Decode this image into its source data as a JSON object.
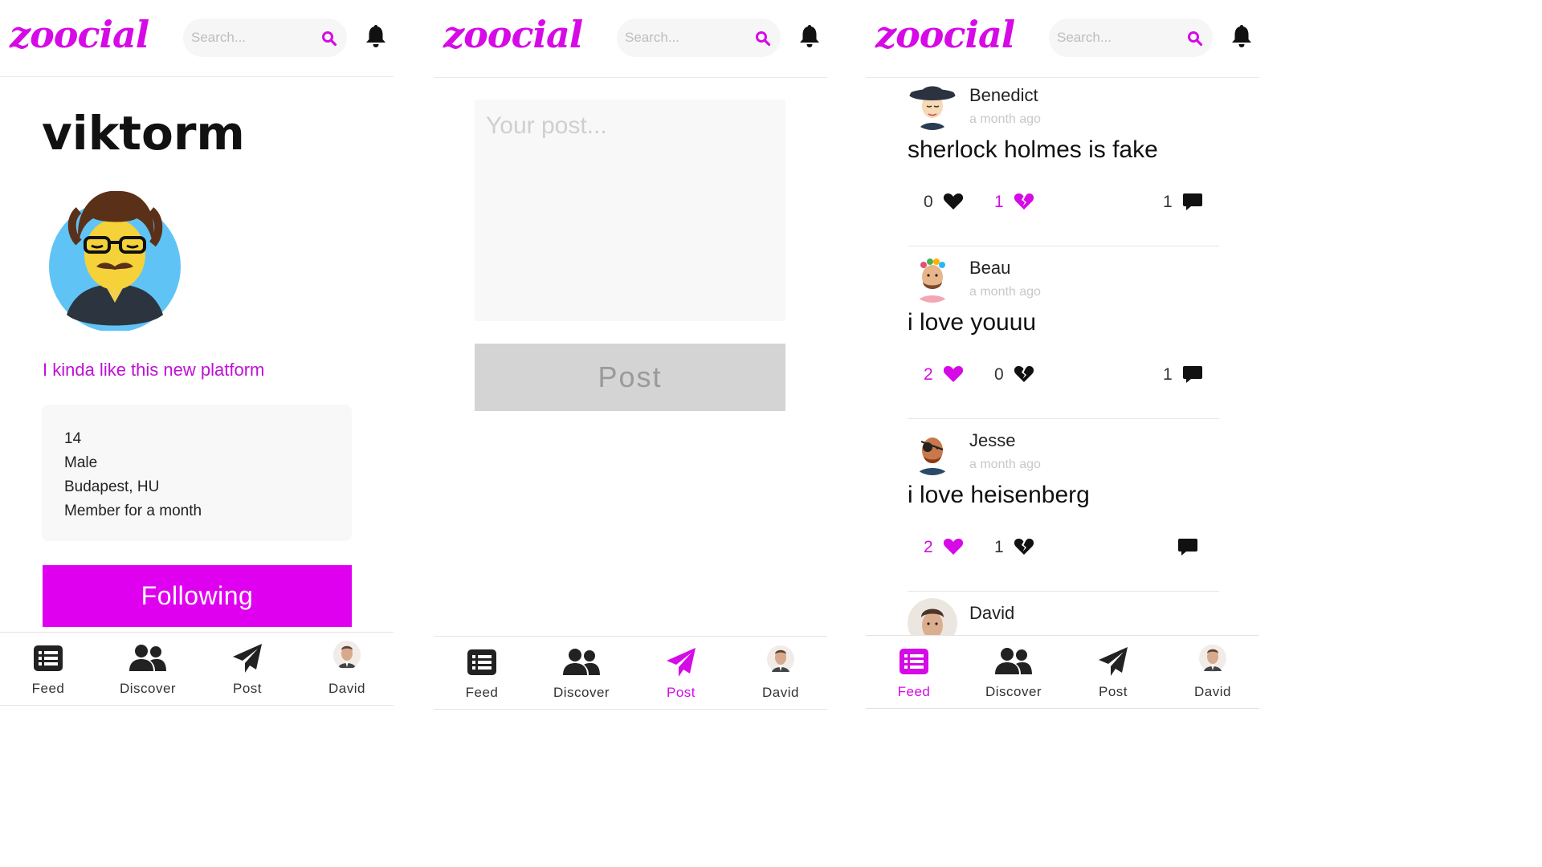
{
  "panels": [
    {
      "header": {
        "logo": "zoocial",
        "search_placeholder": "Search..."
      },
      "profile": {
        "username": "viktorm",
        "bio": "I kinda like this new platform",
        "info": [
          "14",
          "Male",
          "Budapest, HU",
          "Member for a month"
        ],
        "follow_label": "Following"
      },
      "nav": {
        "items": [
          "Feed",
          "Discover",
          "Post",
          "David"
        ],
        "active": ""
      }
    },
    {
      "header": {
        "logo": "zoocial",
        "search_placeholder": "Search..."
      },
      "compose": {
        "placeholder": "Your post...",
        "post_label": "Post"
      },
      "nav": {
        "items": [
          "Feed",
          "Discover",
          "Post",
          "David"
        ],
        "active": "Post"
      }
    },
    {
      "header": {
        "logo": "zoocial",
        "search_placeholder": "Search..."
      },
      "feed": [
        {
          "author": "Benedict",
          "time": "a month ago",
          "text": "sherlock holmes is fake",
          "likes": "0",
          "broken": "1",
          "comments": "1",
          "liked": false,
          "broken_active": true
        },
        {
          "author": "Beau",
          "time": "a month ago",
          "text": "i love youuu",
          "likes": "2",
          "broken": "0",
          "comments": "1",
          "liked": true,
          "broken_active": false
        },
        {
          "author": "Jesse",
          "time": "a month ago",
          "text": "i love heisenberg",
          "likes": "2",
          "broken": "1",
          "comments": "",
          "liked": true,
          "broken_active": false
        },
        {
          "author": "David"
        }
      ],
      "nav": {
        "items": [
          "Feed",
          "Discover",
          "Post",
          "David"
        ],
        "active": "Feed"
      }
    }
  ],
  "colors": {
    "accent": "#d60ae6",
    "button": "#e000f0",
    "muted": "#c8c8c8",
    "card": "#f8f8f8"
  },
  "icons": [
    "search-icon",
    "bell-icon",
    "feed-icon",
    "discover-icon",
    "post-icon",
    "heart-icon",
    "broken-heart-icon",
    "comment-icon"
  ]
}
